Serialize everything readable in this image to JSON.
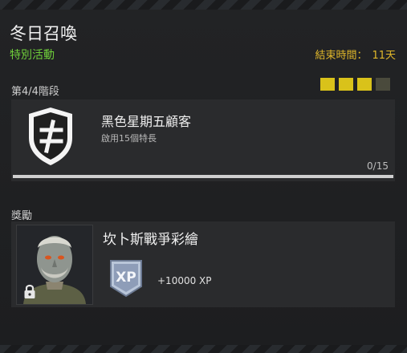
{
  "header": {
    "title": "冬日召喚",
    "subtitle": "特別活動",
    "end_time_label": "結束時間：",
    "end_time_value": "11天"
  },
  "stage": {
    "label": "第4/4階段",
    "completed": 3,
    "total": 4
  },
  "challenge": {
    "name": "黑色星期五顧客",
    "description": "啟用15個特長",
    "progress_text": "0/15",
    "progress_fraction": 0,
    "badge_icon": "hashtag-shield-icon"
  },
  "reward": {
    "section_label": "獎勵",
    "name": "坎卜斯戰爭彩繪",
    "locked": true,
    "xp_icon_text": "XP",
    "xp_text": "+10000 XP"
  },
  "colors": {
    "accent_green": "#6fcf3a",
    "accent_yellow": "#e0b72a",
    "stage_on": "#d9c21a",
    "stage_off": "#4a4a3c"
  }
}
